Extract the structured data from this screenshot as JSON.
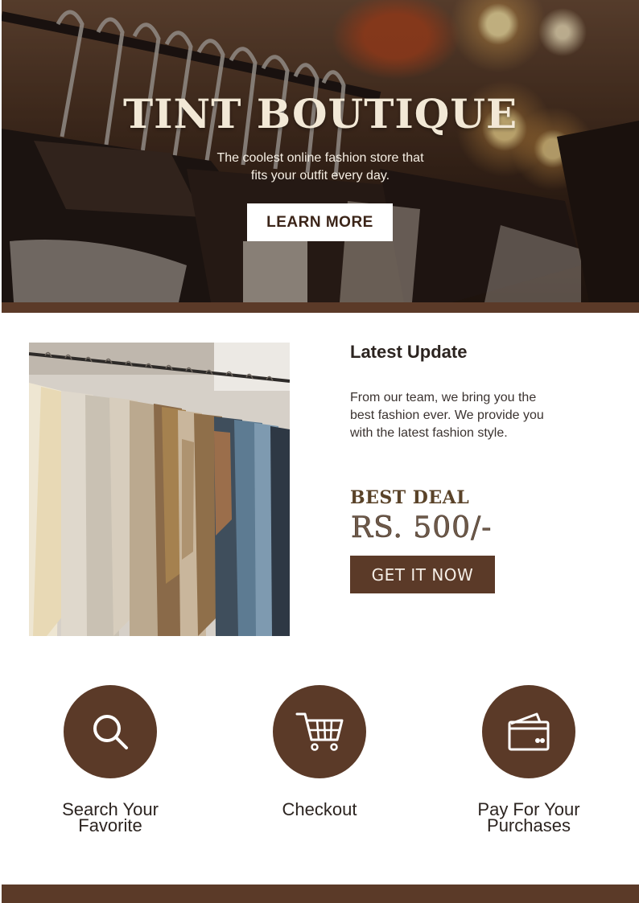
{
  "hero": {
    "title": "TINT BOUTIQUE",
    "subtitle_line1": "The coolest online fashion store that",
    "subtitle_line2": "fits your outfit every day.",
    "cta_label": "LEARN MORE"
  },
  "update": {
    "title": "Latest Update",
    "body_line1": "From our team, we bring you the",
    "body_line2": "best fashion ever. We provide you",
    "body_line3": "with the latest fashion style."
  },
  "deal": {
    "label": "BEST DEAL",
    "price": "RS. 500/-",
    "cta_label": "GET IT NOW"
  },
  "features": [
    {
      "icon": "search-icon",
      "line1": "Search Your",
      "line2": "Favorite"
    },
    {
      "icon": "cart-icon",
      "line1": "Checkout",
      "line2": ""
    },
    {
      "icon": "wallet-icon",
      "line1": "Pay For Your",
      "line2": "Purchases"
    }
  ],
  "colors": {
    "brand_brown": "#5b3a28",
    "deal_text": "#5a4329",
    "white": "#ffffff"
  }
}
